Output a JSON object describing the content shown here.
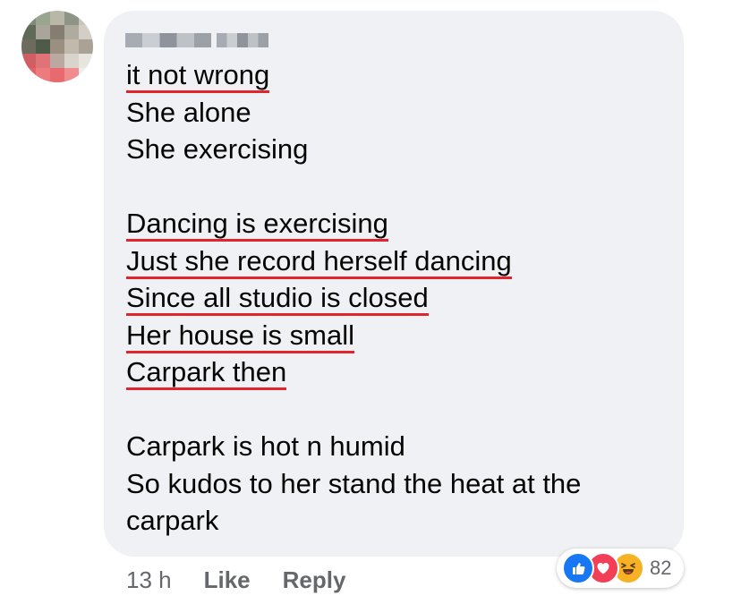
{
  "comment": {
    "lines": [
      "it not wrong",
      "She alone",
      "She exercising",
      "",
      "Dancing is exercising",
      "Just she record herself dancing",
      "Since all studio is closed",
      "Her house is small",
      "Carpark then",
      "",
      "Carpark is hot n humid",
      "So kudos to her stand the heat at the",
      "carpark"
    ]
  },
  "footer": {
    "time": "13 h",
    "like": "Like",
    "reply": "Reply"
  },
  "reactions": {
    "icons": [
      "like-icon",
      "love-icon",
      "haha-icon"
    ],
    "count": "82"
  },
  "colors": {
    "bubble": "#eff1f4",
    "underline": "#e0262c",
    "like": "#1877f2",
    "love": "#f33e58",
    "haha": "#f7b125"
  }
}
